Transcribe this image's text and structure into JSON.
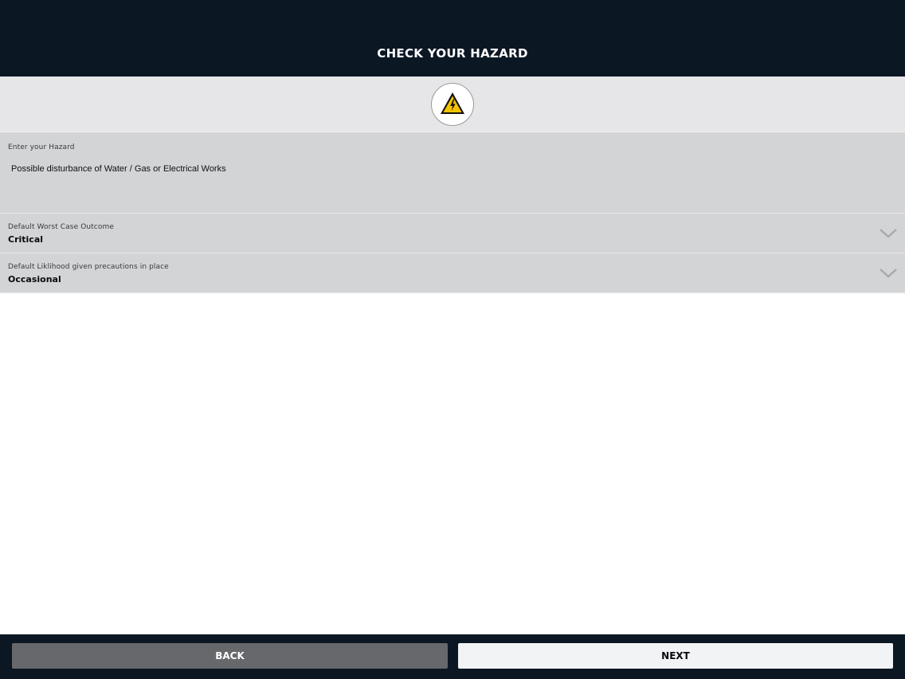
{
  "header": {
    "title": "CHECK YOUR HAZARD"
  },
  "hazard_icon": {
    "name": "electrical-hazard-icon",
    "colors": {
      "triangle": "#f5c400",
      "outline": "#111111"
    }
  },
  "hazard_input": {
    "label": "Enter your Hazard",
    "value": "Possible disturbance of Water / Gas or Electrical Works"
  },
  "worst_case": {
    "label": "Default Worst Case Outcome",
    "value": "Critical"
  },
  "likelihood": {
    "label": "Default Liklihood given precautions in place",
    "value": "Occasional"
  },
  "footer": {
    "back_label": "BACK",
    "next_label": "NEXT"
  }
}
